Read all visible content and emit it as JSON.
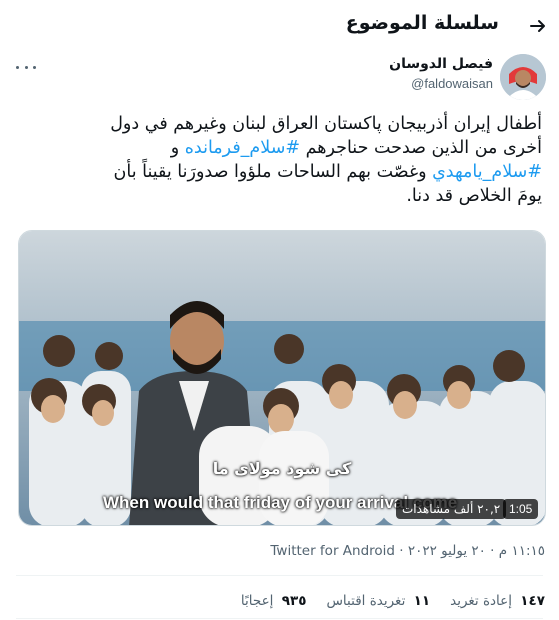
{
  "header": {
    "title": "سلسلة الموضوع",
    "back_icon": "arrow-right-icon"
  },
  "author": {
    "name": "فيصل الدوسان",
    "handle": "@faldowaisan",
    "more_icon": "more-dots-icon"
  },
  "tweet": {
    "line1": "أطفال إيران أذربيجان پاكستان العراق لبنان وغيرهم في دول",
    "line2_text": "أخرى من الذين صدحت حناجرهم ",
    "line2_hashtag": "#سلام_فرمانده",
    "line2_tail": " و",
    "line3_hashtag": "#سلام_يامهدي",
    "line3_tail": " وغصّت بهم الساحات ملؤوا صدورَنا يقيناً بأن",
    "line4": "يومَ الخلاص قد دنا."
  },
  "media": {
    "subtitle_ar": "کی شود مولای ما",
    "subtitle_en": "When would that friday of your arrival come",
    "views": "٢٠,٢ ألف مشاهدات",
    "duration": "1:05"
  },
  "meta": {
    "time": "١١:١٥ م",
    "date": "٢٠ يوليو ٢٠٢٢",
    "source": "Twitter for Android"
  },
  "stats": {
    "retweets_count": "١٤٧",
    "retweets_label": "إعادة تغريد",
    "quotes_count": "١١",
    "quotes_label": "تغريدة اقتباس",
    "likes_count": "٩٣٥",
    "likes_label": "إعجابًا"
  },
  "colors": {
    "accent": "#1d9bf0",
    "secondary_text": "#536471",
    "primary_text": "#0f1419"
  }
}
